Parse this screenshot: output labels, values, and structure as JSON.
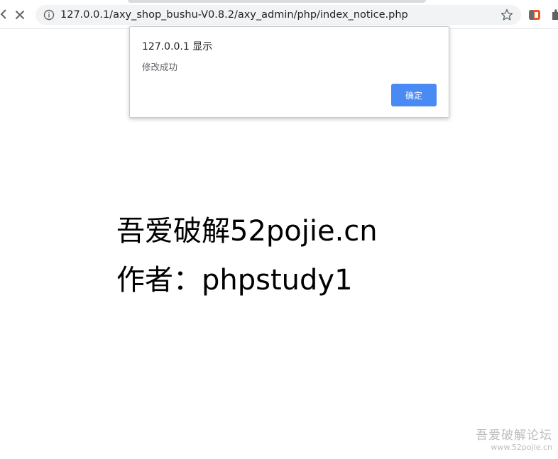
{
  "browser": {
    "url": "127.0.0.1/axy_shop_bushu-V0.8.2/axy_admin/php/index_notice.php",
    "icons": {
      "back": "back-arrow-icon",
      "stop": "close-icon",
      "site_info": "info-icon",
      "bookmark": "star-icon",
      "extension": "extension-icon",
      "extensions_menu": "puzzle-icon"
    }
  },
  "dialog": {
    "title": "127.0.0.1 显示",
    "message": "修改成功",
    "ok_label": "确定"
  },
  "page": {
    "line1": "吾爱破解52pojie.cn",
    "line2": "作者：phpstudy1"
  },
  "watermark": {
    "title": "吾爱破解论坛",
    "url": "www.52pojie.cn"
  },
  "colors": {
    "accent": "#4a8af4",
    "omnibox_bg": "#f1f3f4",
    "text": "#000000"
  }
}
